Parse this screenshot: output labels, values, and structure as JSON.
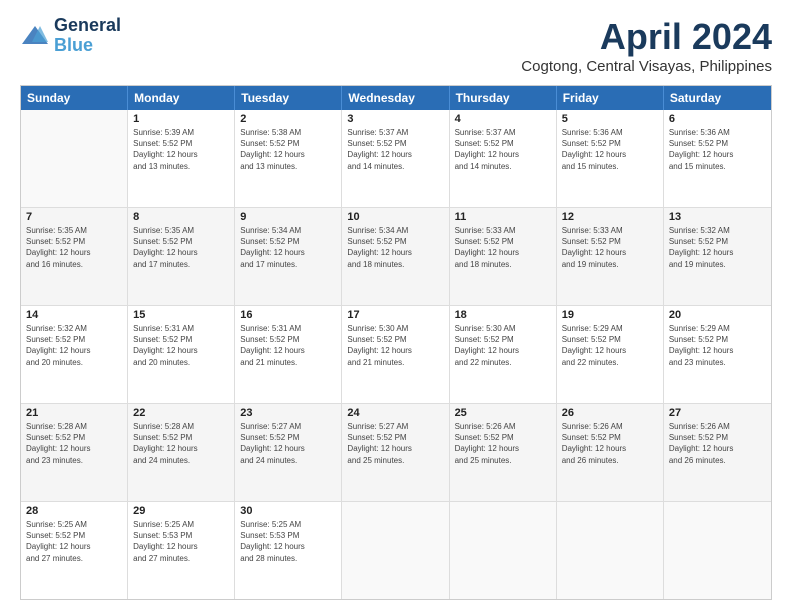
{
  "header": {
    "logo_line1": "General",
    "logo_line2": "Blue",
    "title": "April 2024",
    "subtitle": "Cogtong, Central Visayas, Philippines"
  },
  "calendar": {
    "weekdays": [
      "Sunday",
      "Monday",
      "Tuesday",
      "Wednesday",
      "Thursday",
      "Friday",
      "Saturday"
    ],
    "rows": [
      [
        {
          "day": "",
          "info": ""
        },
        {
          "day": "1",
          "info": "Sunrise: 5:39 AM\nSunset: 5:52 PM\nDaylight: 12 hours\nand 13 minutes."
        },
        {
          "day": "2",
          "info": "Sunrise: 5:38 AM\nSunset: 5:52 PM\nDaylight: 12 hours\nand 13 minutes."
        },
        {
          "day": "3",
          "info": "Sunrise: 5:37 AM\nSunset: 5:52 PM\nDaylight: 12 hours\nand 14 minutes."
        },
        {
          "day": "4",
          "info": "Sunrise: 5:37 AM\nSunset: 5:52 PM\nDaylight: 12 hours\nand 14 minutes."
        },
        {
          "day": "5",
          "info": "Sunrise: 5:36 AM\nSunset: 5:52 PM\nDaylight: 12 hours\nand 15 minutes."
        },
        {
          "day": "6",
          "info": "Sunrise: 5:36 AM\nSunset: 5:52 PM\nDaylight: 12 hours\nand 15 minutes."
        }
      ],
      [
        {
          "day": "7",
          "info": "Sunrise: 5:35 AM\nSunset: 5:52 PM\nDaylight: 12 hours\nand 16 minutes."
        },
        {
          "day": "8",
          "info": "Sunrise: 5:35 AM\nSunset: 5:52 PM\nDaylight: 12 hours\nand 17 minutes."
        },
        {
          "day": "9",
          "info": "Sunrise: 5:34 AM\nSunset: 5:52 PM\nDaylight: 12 hours\nand 17 minutes."
        },
        {
          "day": "10",
          "info": "Sunrise: 5:34 AM\nSunset: 5:52 PM\nDaylight: 12 hours\nand 18 minutes."
        },
        {
          "day": "11",
          "info": "Sunrise: 5:33 AM\nSunset: 5:52 PM\nDaylight: 12 hours\nand 18 minutes."
        },
        {
          "day": "12",
          "info": "Sunrise: 5:33 AM\nSunset: 5:52 PM\nDaylight: 12 hours\nand 19 minutes."
        },
        {
          "day": "13",
          "info": "Sunrise: 5:32 AM\nSunset: 5:52 PM\nDaylight: 12 hours\nand 19 minutes."
        }
      ],
      [
        {
          "day": "14",
          "info": "Sunrise: 5:32 AM\nSunset: 5:52 PM\nDaylight: 12 hours\nand 20 minutes."
        },
        {
          "day": "15",
          "info": "Sunrise: 5:31 AM\nSunset: 5:52 PM\nDaylight: 12 hours\nand 20 minutes."
        },
        {
          "day": "16",
          "info": "Sunrise: 5:31 AM\nSunset: 5:52 PM\nDaylight: 12 hours\nand 21 minutes."
        },
        {
          "day": "17",
          "info": "Sunrise: 5:30 AM\nSunset: 5:52 PM\nDaylight: 12 hours\nand 21 minutes."
        },
        {
          "day": "18",
          "info": "Sunrise: 5:30 AM\nSunset: 5:52 PM\nDaylight: 12 hours\nand 22 minutes."
        },
        {
          "day": "19",
          "info": "Sunrise: 5:29 AM\nSunset: 5:52 PM\nDaylight: 12 hours\nand 22 minutes."
        },
        {
          "day": "20",
          "info": "Sunrise: 5:29 AM\nSunset: 5:52 PM\nDaylight: 12 hours\nand 23 minutes."
        }
      ],
      [
        {
          "day": "21",
          "info": "Sunrise: 5:28 AM\nSunset: 5:52 PM\nDaylight: 12 hours\nand 23 minutes."
        },
        {
          "day": "22",
          "info": "Sunrise: 5:28 AM\nSunset: 5:52 PM\nDaylight: 12 hours\nand 24 minutes."
        },
        {
          "day": "23",
          "info": "Sunrise: 5:27 AM\nSunset: 5:52 PM\nDaylight: 12 hours\nand 24 minutes."
        },
        {
          "day": "24",
          "info": "Sunrise: 5:27 AM\nSunset: 5:52 PM\nDaylight: 12 hours\nand 25 minutes."
        },
        {
          "day": "25",
          "info": "Sunrise: 5:26 AM\nSunset: 5:52 PM\nDaylight: 12 hours\nand 25 minutes."
        },
        {
          "day": "26",
          "info": "Sunrise: 5:26 AM\nSunset: 5:52 PM\nDaylight: 12 hours\nand 26 minutes."
        },
        {
          "day": "27",
          "info": "Sunrise: 5:26 AM\nSunset: 5:52 PM\nDaylight: 12 hours\nand 26 minutes."
        }
      ],
      [
        {
          "day": "28",
          "info": "Sunrise: 5:25 AM\nSunset: 5:52 PM\nDaylight: 12 hours\nand 27 minutes."
        },
        {
          "day": "29",
          "info": "Sunrise: 5:25 AM\nSunset: 5:53 PM\nDaylight: 12 hours\nand 27 minutes."
        },
        {
          "day": "30",
          "info": "Sunrise: 5:25 AM\nSunset: 5:53 PM\nDaylight: 12 hours\nand 28 minutes."
        },
        {
          "day": "",
          "info": ""
        },
        {
          "day": "",
          "info": ""
        },
        {
          "day": "",
          "info": ""
        },
        {
          "day": "",
          "info": ""
        }
      ]
    ]
  }
}
